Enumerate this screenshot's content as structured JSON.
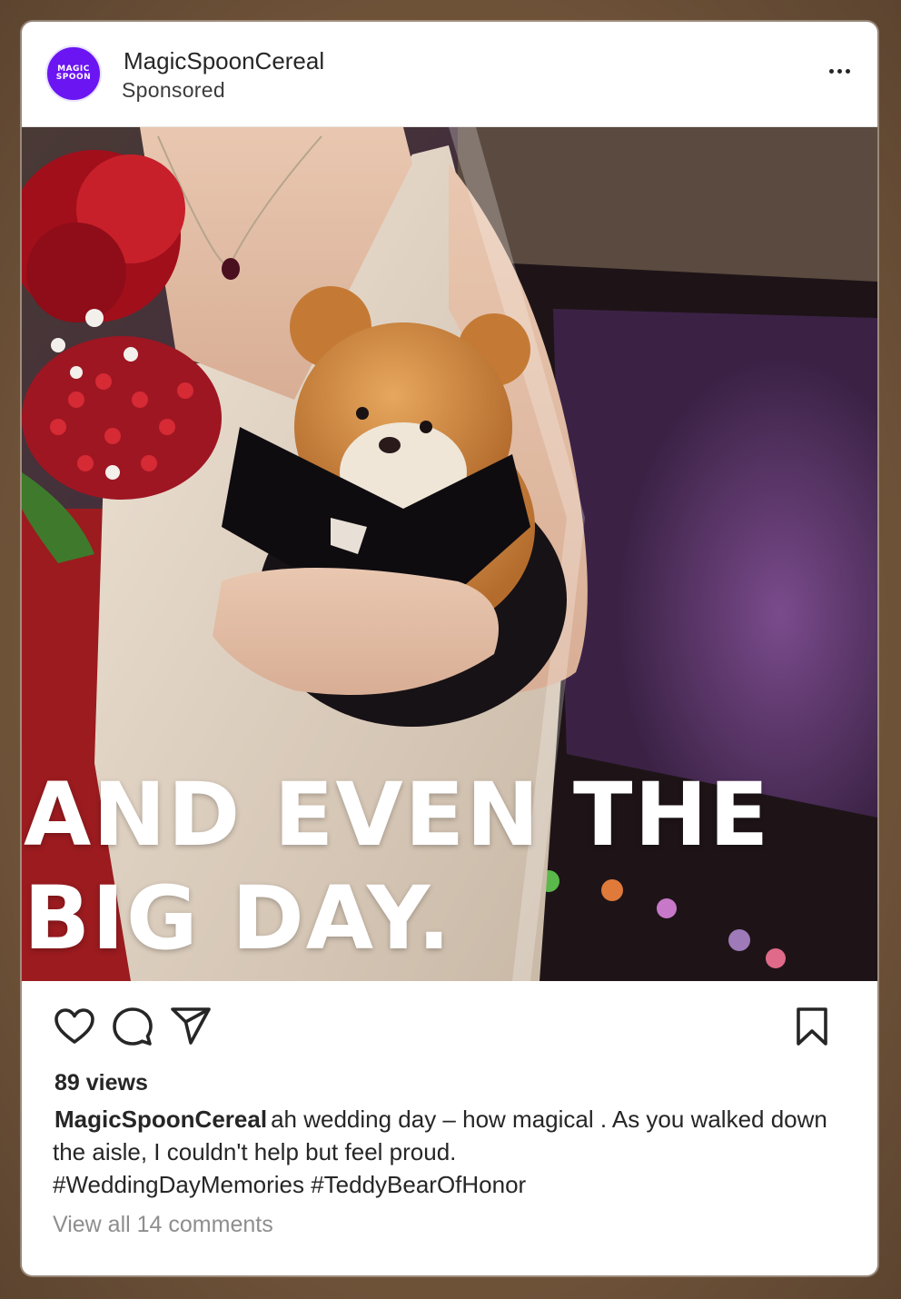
{
  "post": {
    "account_name": "MagicSpoonCereal",
    "sponsored_label": "Sponsored",
    "avatar": {
      "line1": "MAGIC",
      "line2": "SPOON",
      "color": "#6b15f2"
    },
    "more_icon": "more-horizontal-icon",
    "media": {
      "overlay_line1": "AND EVEN THE",
      "overlay_line2": "BIG DAY."
    },
    "actions": {
      "like_icon": "heart-icon",
      "comment_icon": "comment-bubble-icon",
      "share_icon": "paper-plane-icon",
      "save_icon": "bookmark-icon"
    },
    "views": "89 views",
    "caption": {
      "username": "MagicSpoonCereal",
      "text": "ah wedding day – how magical  . As you walked down the aisle, I couldn't help but feel proud.",
      "hashtags": "#WeddingDayMemories #TeddyBearOfHonor"
    },
    "comments_link": "View all 14 comments"
  }
}
